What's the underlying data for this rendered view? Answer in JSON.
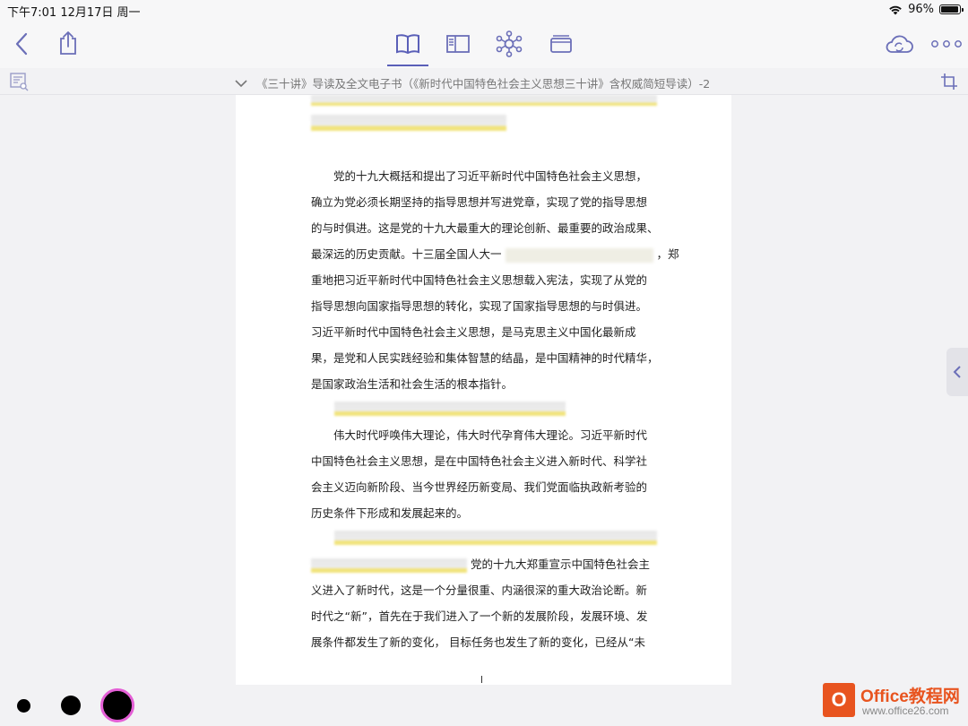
{
  "status_bar": {
    "datetime": "下午7:01   12月17日 周一",
    "battery_text": "96%",
    "battery_level": 0.96
  },
  "toolbar": {
    "icons": [
      "back-icon",
      "share-icon",
      "book-icon",
      "panel-icon",
      "mindmap-icon",
      "cards-icon",
      "cloud-sync-icon",
      "more-icon"
    ]
  },
  "document": {
    "title": "《三十讲》导读及全文电子书（《新时代中国特色社会主义思想三十讲》含权威简短导读）-2",
    "para1": [
      "党的十九大概括和提出了习近平新时代中国特色社会主义思想，",
      "确立为党必须长期坚持的指导思想并写进党章，实现了党的指导思想",
      "的与时俱进。这是党的十九大最重大的理论创新、最重要的政治成果、",
      "最深远的历史贡献。十三届全国人大一",
      "，郑",
      "重地把习近平新时代中国特色社会主义思想载入宪法，实现了从党的",
      "指导思想向国家指导思想的转化，实现了国家指导思想的与时俱进。",
      "习近平新时代中国特色社会主义思想，是马克思主义中国化最新成",
      "果，是党和人民实践经验和集体智慧的结晶，是中国精神的时代精华，",
      "是国家政治生活和社会生活的根本指针。"
    ],
    "para2": [
      "伟大时代呼唤伟大理论，伟大时代孕育伟大理论。习近平新时代",
      "中国特色社会主义思想，是在中国特色社会主义进入新时代、科学社",
      "会主义迈向新阶段、当今世界经历新变局、我们党面临执政新考验的",
      "历史条件下形成和发展起来的。"
    ],
    "para3": [
      "党的十九大郑重宣示中国特色社会主",
      "义进入了新时代，这是一个分量很重、内涵很深的重大政治论断。新",
      "时代之“新”，首先在于我们进入了一个新的发展阶段，发展环境、发",
      "展条件都发生了新的变化， 目标任务也发生了新的变化，已经从“未"
    ]
  },
  "watermark": {
    "logo_letter": "O",
    "name": "Office教程网",
    "url": "www.office26.com"
  },
  "colors": {
    "accent": "#5a5fb8",
    "highlight": "#f1e37a",
    "logo": "#e8541f"
  }
}
